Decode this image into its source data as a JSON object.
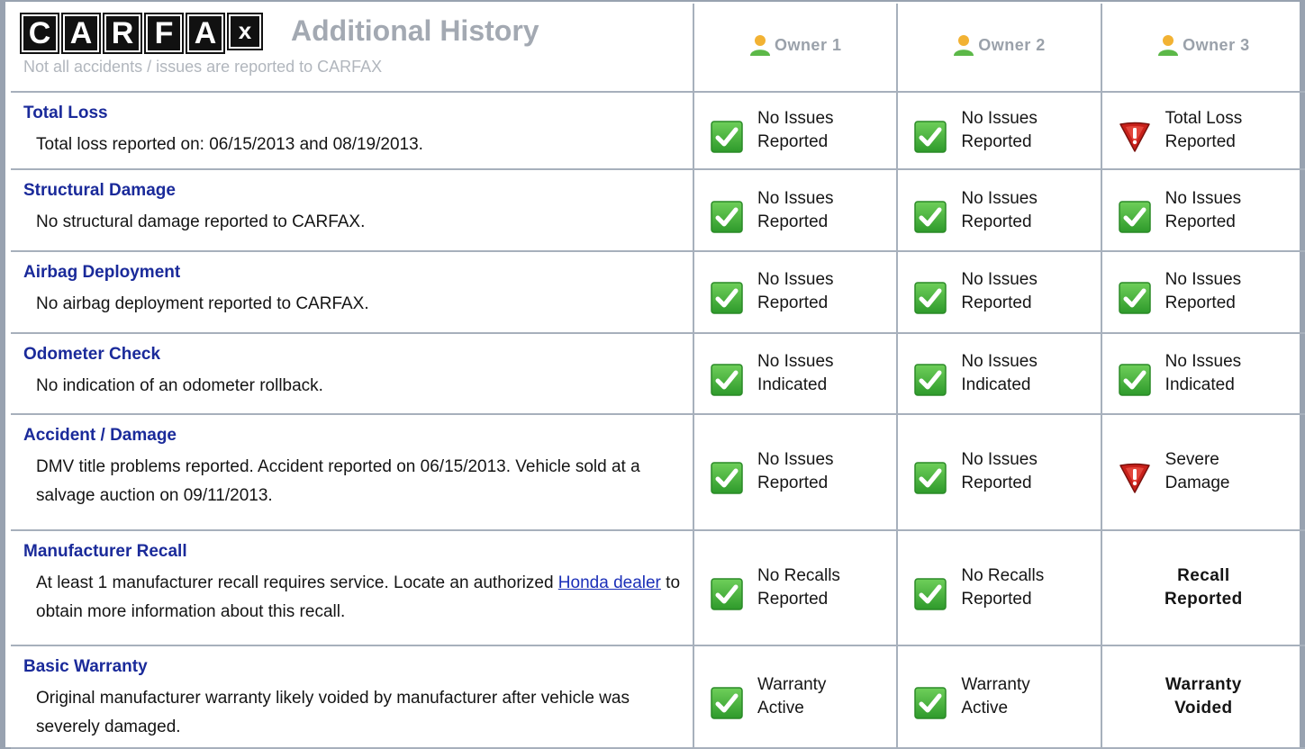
{
  "header": {
    "logo_letters": [
      "C",
      "A",
      "R",
      "F",
      "A",
      "x"
    ],
    "title": "Additional History",
    "subtitle": "Not all accidents / issues are reported to CARFAX",
    "owners": [
      "Owner 1",
      "Owner 2",
      "Owner 3"
    ]
  },
  "colors": {
    "category_title": "#1a2a9a",
    "check_green": "#3ea838",
    "warn_red": "#c8201a",
    "border": "#a7b0bc"
  },
  "rows": [
    {
      "title": "Total Loss",
      "description": "Total loss reported on: 06/15/2013 and 08/19/2013.",
      "owners": [
        {
          "icon": "check-icon",
          "line1": "No Issues",
          "line2": "Reported"
        },
        {
          "icon": "check-icon",
          "line1": "No Issues",
          "line2": "Reported"
        },
        {
          "icon": "warning-icon",
          "line1": "Total Loss",
          "line2": "Reported"
        }
      ]
    },
    {
      "title": "Structural Damage",
      "description": "No structural damage reported to CARFAX.",
      "owners": [
        {
          "icon": "check-icon",
          "line1": "No Issues",
          "line2": "Reported"
        },
        {
          "icon": "check-icon",
          "line1": "No Issues",
          "line2": "Reported"
        },
        {
          "icon": "check-icon",
          "line1": "No Issues",
          "line2": "Reported"
        }
      ]
    },
    {
      "title": "Airbag Deployment",
      "description": "No airbag deployment reported to CARFAX.",
      "owners": [
        {
          "icon": "check-icon",
          "line1": "No Issues",
          "line2": "Reported"
        },
        {
          "icon": "check-icon",
          "line1": "No Issues",
          "line2": "Reported"
        },
        {
          "icon": "check-icon",
          "line1": "No Issues",
          "line2": "Reported"
        }
      ]
    },
    {
      "title": "Odometer Check",
      "description": "No indication of an odometer rollback.",
      "owners": [
        {
          "icon": "check-icon",
          "line1": "No Issues",
          "line2": "Indicated"
        },
        {
          "icon": "check-icon",
          "line1": "No Issues",
          "line2": "Indicated"
        },
        {
          "icon": "check-icon",
          "line1": "No Issues",
          "line2": "Indicated"
        }
      ]
    },
    {
      "title": "Accident / Damage",
      "description": "DMV title problems reported. Accident reported on 06/15/2013. Vehicle sold at a salvage auction on 09/11/2013.",
      "owners": [
        {
          "icon": "check-icon",
          "line1": "No Issues",
          "line2": "Reported"
        },
        {
          "icon": "check-icon",
          "line1": "No Issues",
          "line2": "Reported"
        },
        {
          "icon": "warning-icon",
          "line1": "Severe",
          "line2": "Damage"
        }
      ]
    },
    {
      "title": "Manufacturer Recall",
      "description_before": "At least 1 manufacturer recall requires service. Locate an authorized ",
      "description_link": "Honda dealer",
      "description_after": " to obtain more information about this recall.",
      "owners": [
        {
          "icon": "check-icon",
          "line1": "No Recalls",
          "line2": "Reported"
        },
        {
          "icon": "check-icon",
          "line1": "No Recalls",
          "line2": "Reported"
        },
        {
          "icon": "none",
          "line1": "Recall",
          "line2": "Reported"
        }
      ]
    },
    {
      "title": "Basic Warranty",
      "description": "Original manufacturer warranty likely voided by manufacturer after vehicle was severely damaged.",
      "owners": [
        {
          "icon": "check-icon",
          "line1": "Warranty",
          "line2": "Active"
        },
        {
          "icon": "check-icon",
          "line1": "Warranty",
          "line2": "Active"
        },
        {
          "icon": "none",
          "line1": "Warranty",
          "line2": "Voided"
        }
      ]
    }
  ]
}
